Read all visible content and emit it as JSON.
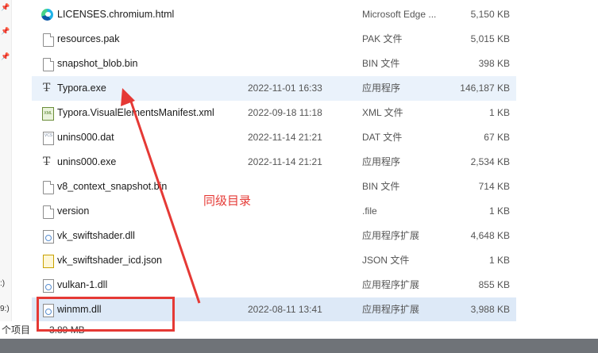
{
  "nav_pane": {
    "pins": [
      "pin-icon",
      "pin-icon",
      "pin-icon"
    ],
    "drives": [
      ":)",
      "9:)"
    ]
  },
  "files": [
    {
      "name": "LICENSES.chromium.html",
      "date": "",
      "type": "Microsoft Edge ...",
      "size": "5,150 KB",
      "icon": "edge-icon"
    },
    {
      "name": "resources.pak",
      "date": "",
      "type": "PAK 文件",
      "size": "5,015 KB",
      "icon": "file-icon"
    },
    {
      "name": "snapshot_blob.bin",
      "date": "",
      "type": "BIN 文件",
      "size": "398 KB",
      "icon": "file-icon"
    },
    {
      "name": "Typora.exe",
      "date": "2022-11-01 16:33",
      "type": "应用程序",
      "size": "146,187 KB",
      "icon": "typora-icon"
    },
    {
      "name": "Typora.VisualElementsManifest.xml",
      "date": "2022-09-18 11:18",
      "type": "XML 文件",
      "size": "1 KB",
      "icon": "xml-icon"
    },
    {
      "name": "unins000.dat",
      "date": "2022-11-14 21:21",
      "type": "DAT 文件",
      "size": "67 KB",
      "icon": "dat-icon"
    },
    {
      "name": "unins000.exe",
      "date": "2022-11-14 21:21",
      "type": "应用程序",
      "size": "2,534 KB",
      "icon": "typora-icon"
    },
    {
      "name": "v8_context_snapshot.bin",
      "date": "",
      "type": "BIN 文件",
      "size": "714 KB",
      "icon": "file-icon"
    },
    {
      "name": "version",
      "date": "",
      "type": ".file",
      "size": "1 KB",
      "icon": "file-icon"
    },
    {
      "name": "vk_swiftshader.dll",
      "date": "",
      "type": "应用程序扩展",
      "size": "4,648 KB",
      "icon": "dll-icon"
    },
    {
      "name": "vk_swiftshader_icd.json",
      "date": "",
      "type": "JSON 文件",
      "size": "1 KB",
      "icon": "json-icon"
    },
    {
      "name": "vulkan-1.dll",
      "date": "",
      "type": "应用程序扩展",
      "size": "855 KB",
      "icon": "dll-icon"
    },
    {
      "name": "winmm.dll",
      "date": "2022-08-11 13:41",
      "type": "应用程序扩展",
      "size": "3,988 KB",
      "icon": "dll-icon"
    }
  ],
  "status_bar": {
    "item_count": "个项目",
    "size_text": "3.89 MB"
  },
  "annotation": {
    "text": "同级目录",
    "color": "#e53935"
  },
  "colors": {
    "selected_row": "#dde9f7",
    "hover_row": "#eaf2fb",
    "taskbar": "#6f7378"
  }
}
